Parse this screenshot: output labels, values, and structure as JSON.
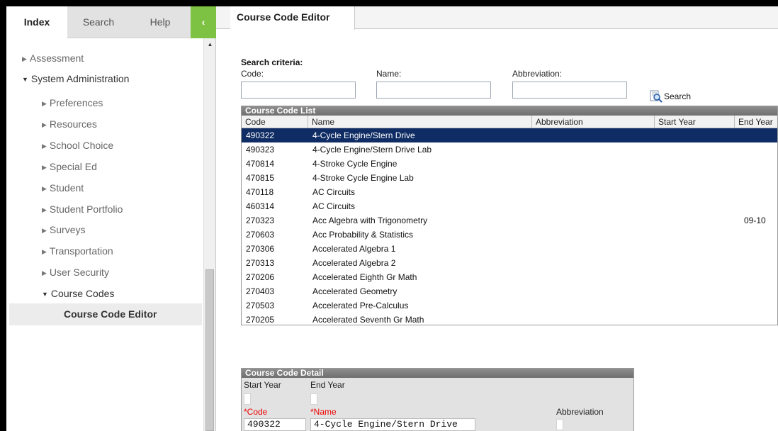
{
  "sidebar": {
    "tabs": {
      "index": "Index",
      "search": "Search",
      "help": "Help"
    },
    "collapse_glyph": "‹",
    "tree": {
      "assessment": "Assessment",
      "system_administration": "System Administration",
      "preferences": "Preferences",
      "resources": "Resources",
      "school_choice": "School Choice",
      "special_ed": "Special Ed",
      "student": "Student",
      "student_portfolio": "Student Portfolio",
      "surveys": "Surveys",
      "transportation": "Transportation",
      "user_security": "User Security",
      "course_codes": "Course Codes",
      "course_code_editor": "Course Code Editor"
    }
  },
  "main": {
    "tab_title": "Course Code Editor",
    "search": {
      "title": "Search criteria:",
      "code_label": "Code:",
      "name_label": "Name:",
      "abbreviation_label": "Abbreviation:",
      "code_value": "",
      "name_value": "",
      "abbreviation_value": "",
      "button_label": "Search"
    },
    "list": {
      "title": "Course Code List",
      "columns": {
        "code": "Code",
        "name": "Name",
        "abbreviation": "Abbreviation",
        "start_year": "Start Year",
        "end_year": "End Year"
      },
      "rows": [
        {
          "code": "490322",
          "name": "4-Cycle Engine/Stern Drive",
          "abbreviation": "",
          "start": "",
          "end": ""
        },
        {
          "code": "490323",
          "name": "4-Cycle Engine/Stern Drive Lab",
          "abbreviation": "",
          "start": "",
          "end": ""
        },
        {
          "code": "470814",
          "name": "4-Stroke Cycle Engine",
          "abbreviation": "",
          "start": "",
          "end": ""
        },
        {
          "code": "470815",
          "name": "4-Stroke Cycle Engine Lab",
          "abbreviation": "",
          "start": "",
          "end": ""
        },
        {
          "code": "470118",
          "name": "AC Circuits",
          "abbreviation": "",
          "start": "",
          "end": ""
        },
        {
          "code": "460314",
          "name": "AC Circuits",
          "abbreviation": "",
          "start": "",
          "end": ""
        },
        {
          "code": "270323",
          "name": "Acc Algebra with Trigonometry",
          "abbreviation": "",
          "start": "",
          "end": "09-10"
        },
        {
          "code": "270603",
          "name": "Acc Probability & Statistics",
          "abbreviation": "",
          "start": "",
          "end": ""
        },
        {
          "code": "270306",
          "name": "Accelerated Algebra 1",
          "abbreviation": "",
          "start": "",
          "end": ""
        },
        {
          "code": "270313",
          "name": "Accelerated Algebra 2",
          "abbreviation": "",
          "start": "",
          "end": ""
        },
        {
          "code": "270206",
          "name": "Accelerated Eighth Gr Math",
          "abbreviation": "",
          "start": "",
          "end": ""
        },
        {
          "code": "270403",
          "name": "Accelerated Geometry",
          "abbreviation": "",
          "start": "",
          "end": ""
        },
        {
          "code": "270503",
          "name": "Accelerated Pre-Calculus",
          "abbreviation": "",
          "start": "",
          "end": ""
        },
        {
          "code": "270205",
          "name": "Accelerated Seventh Gr Math",
          "abbreviation": "",
          "start": "",
          "end": ""
        }
      ]
    },
    "detail": {
      "title": "Course Code Detail",
      "start_year_label": "Start Year",
      "end_year_label": "End Year",
      "code_label": "*Code",
      "name_label": "*Name",
      "abbreviation_label": "Abbreviation",
      "code_value": "490322",
      "name_value": "4-Cycle Engine/Stern Drive"
    }
  },
  "colors": {
    "selected_row": "#0f2c64",
    "collapse_button": "#7dc242",
    "required_label": "#e00000"
  }
}
